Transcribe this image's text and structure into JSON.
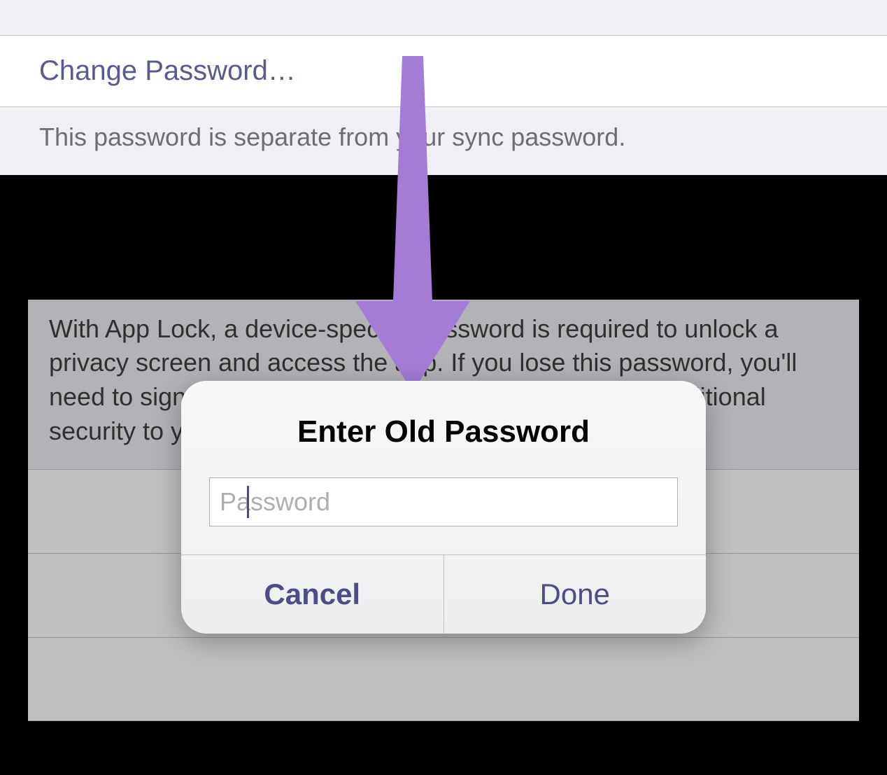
{
  "settings": {
    "change_password_label": "Change Password…",
    "footer_note": "This password is separate from your sync password.",
    "app_lock_description": "With App Lock, a device-specific password is required to unlock a privacy screen and access the app. If you lose this password, you'll need to sign out. App Lock does not add encryption or additional security to your account or documents."
  },
  "dialog": {
    "title": "Enter Old Password",
    "password_placeholder": "Password",
    "cancel_label": "Cancel",
    "done_label": "Done"
  },
  "annotation": {
    "arrow_color": "#a37cd6"
  }
}
